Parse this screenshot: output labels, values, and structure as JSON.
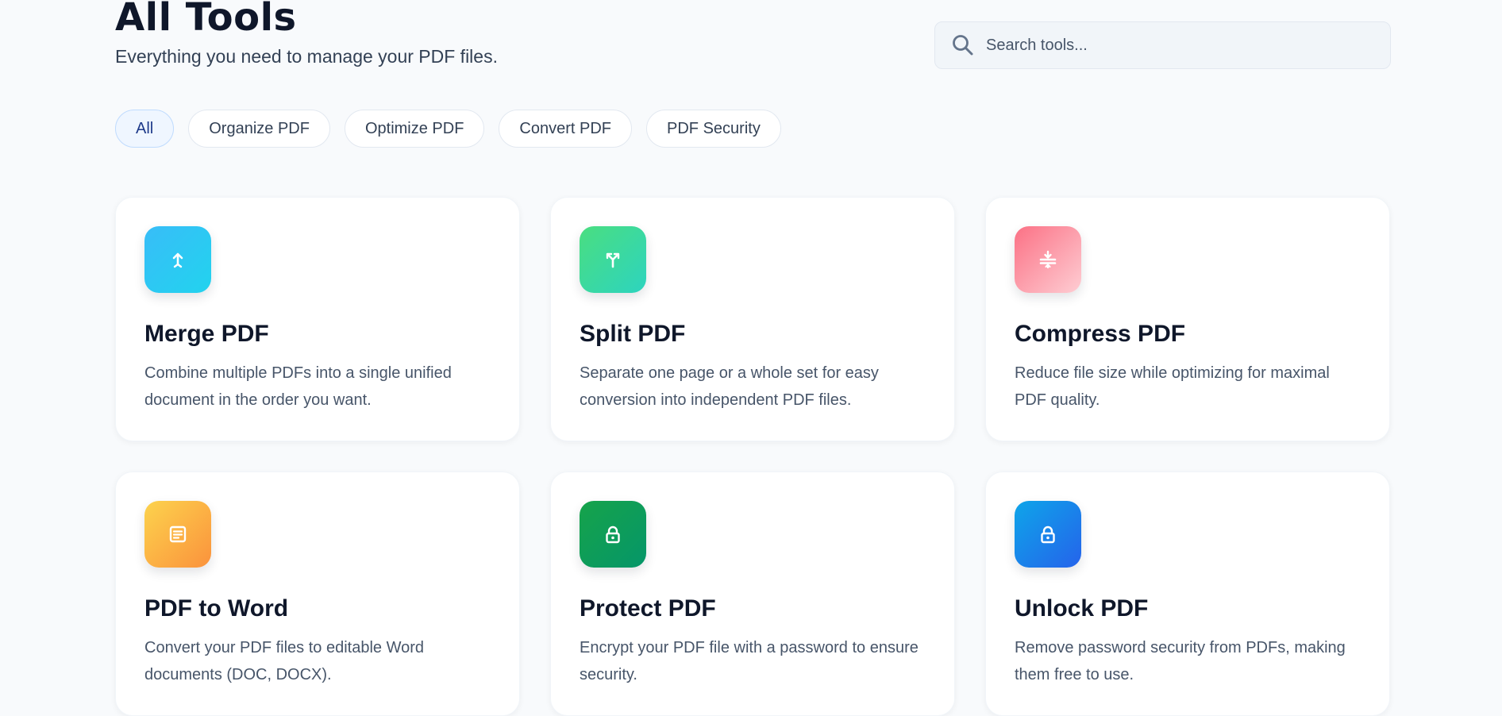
{
  "header": {
    "title": "All Tools",
    "subtitle": "Everything you need to manage your PDF files."
  },
  "search": {
    "placeholder": "Search tools...",
    "value": "",
    "icon": "search-icon"
  },
  "filters": [
    {
      "label": "All",
      "active": true
    },
    {
      "label": "Organize PDF",
      "active": false
    },
    {
      "label": "Optimize PDF",
      "active": false
    },
    {
      "label": "Convert PDF",
      "active": false
    },
    {
      "label": "PDF Security",
      "active": false
    }
  ],
  "tools": [
    {
      "title": "Merge PDF",
      "description": "Combine multiple PDFs into a single unified document in the order you want.",
      "icon": "merge-icon",
      "gradient": [
        "#38bdf8",
        "#22d3ee"
      ]
    },
    {
      "title": "Split PDF",
      "description": "Separate one page or a whole set for easy conversion into independent PDF files.",
      "icon": "split-icon",
      "gradient": [
        "#4ade80",
        "#2dd4bf"
      ]
    },
    {
      "title": "Compress PDF",
      "description": "Reduce file size while optimizing for maximal PDF quality.",
      "icon": "compress-icon",
      "gradient": [
        "#fb7185",
        "#fda4af"
      ]
    },
    {
      "title": "PDF to Word",
      "description": "Convert your PDF files to editable Word documents (DOC, DOCX).",
      "icon": "document-icon",
      "gradient": [
        "#fcd34d",
        "#fb923c"
      ]
    },
    {
      "title": "Protect PDF",
      "description": "Encrypt your PDF file with a password to ensure security.",
      "icon": "lock-icon",
      "gradient": [
        "#16a34a",
        "#059669"
      ]
    },
    {
      "title": "Unlock PDF",
      "description": "Remove password security from PDFs, making them free to use.",
      "icon": "unlock-icon",
      "gradient": [
        "#0ea5e9",
        "#2563eb"
      ]
    }
  ]
}
